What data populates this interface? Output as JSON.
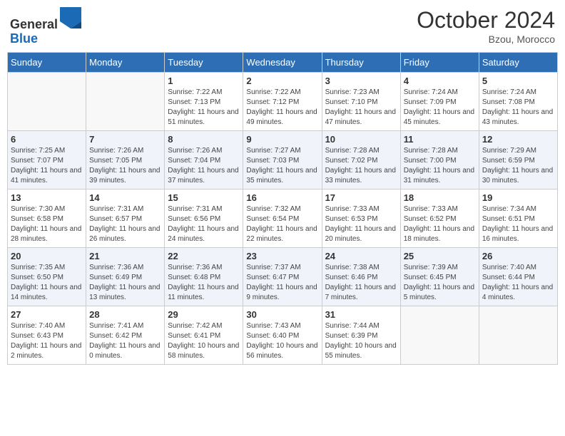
{
  "header": {
    "logo_line1": "General",
    "logo_line2": "Blue",
    "month": "October 2024",
    "location": "Bzou, Morocco"
  },
  "weekdays": [
    "Sunday",
    "Monday",
    "Tuesday",
    "Wednesday",
    "Thursday",
    "Friday",
    "Saturday"
  ],
  "weeks": [
    [
      {
        "day": "",
        "sunrise": "",
        "sunset": "",
        "daylight": ""
      },
      {
        "day": "",
        "sunrise": "",
        "sunset": "",
        "daylight": ""
      },
      {
        "day": "1",
        "sunrise": "Sunrise: 7:22 AM",
        "sunset": "Sunset: 7:13 PM",
        "daylight": "Daylight: 11 hours and 51 minutes."
      },
      {
        "day": "2",
        "sunrise": "Sunrise: 7:22 AM",
        "sunset": "Sunset: 7:12 PM",
        "daylight": "Daylight: 11 hours and 49 minutes."
      },
      {
        "day": "3",
        "sunrise": "Sunrise: 7:23 AM",
        "sunset": "Sunset: 7:10 PM",
        "daylight": "Daylight: 11 hours and 47 minutes."
      },
      {
        "day": "4",
        "sunrise": "Sunrise: 7:24 AM",
        "sunset": "Sunset: 7:09 PM",
        "daylight": "Daylight: 11 hours and 45 minutes."
      },
      {
        "day": "5",
        "sunrise": "Sunrise: 7:24 AM",
        "sunset": "Sunset: 7:08 PM",
        "daylight": "Daylight: 11 hours and 43 minutes."
      }
    ],
    [
      {
        "day": "6",
        "sunrise": "Sunrise: 7:25 AM",
        "sunset": "Sunset: 7:07 PM",
        "daylight": "Daylight: 11 hours and 41 minutes."
      },
      {
        "day": "7",
        "sunrise": "Sunrise: 7:26 AM",
        "sunset": "Sunset: 7:05 PM",
        "daylight": "Daylight: 11 hours and 39 minutes."
      },
      {
        "day": "8",
        "sunrise": "Sunrise: 7:26 AM",
        "sunset": "Sunset: 7:04 PM",
        "daylight": "Daylight: 11 hours and 37 minutes."
      },
      {
        "day": "9",
        "sunrise": "Sunrise: 7:27 AM",
        "sunset": "Sunset: 7:03 PM",
        "daylight": "Daylight: 11 hours and 35 minutes."
      },
      {
        "day": "10",
        "sunrise": "Sunrise: 7:28 AM",
        "sunset": "Sunset: 7:02 PM",
        "daylight": "Daylight: 11 hours and 33 minutes."
      },
      {
        "day": "11",
        "sunrise": "Sunrise: 7:28 AM",
        "sunset": "Sunset: 7:00 PM",
        "daylight": "Daylight: 11 hours and 31 minutes."
      },
      {
        "day": "12",
        "sunrise": "Sunrise: 7:29 AM",
        "sunset": "Sunset: 6:59 PM",
        "daylight": "Daylight: 11 hours and 30 minutes."
      }
    ],
    [
      {
        "day": "13",
        "sunrise": "Sunrise: 7:30 AM",
        "sunset": "Sunset: 6:58 PM",
        "daylight": "Daylight: 11 hours and 28 minutes."
      },
      {
        "day": "14",
        "sunrise": "Sunrise: 7:31 AM",
        "sunset": "Sunset: 6:57 PM",
        "daylight": "Daylight: 11 hours and 26 minutes."
      },
      {
        "day": "15",
        "sunrise": "Sunrise: 7:31 AM",
        "sunset": "Sunset: 6:56 PM",
        "daylight": "Daylight: 11 hours and 24 minutes."
      },
      {
        "day": "16",
        "sunrise": "Sunrise: 7:32 AM",
        "sunset": "Sunset: 6:54 PM",
        "daylight": "Daylight: 11 hours and 22 minutes."
      },
      {
        "day": "17",
        "sunrise": "Sunrise: 7:33 AM",
        "sunset": "Sunset: 6:53 PM",
        "daylight": "Daylight: 11 hours and 20 minutes."
      },
      {
        "day": "18",
        "sunrise": "Sunrise: 7:33 AM",
        "sunset": "Sunset: 6:52 PM",
        "daylight": "Daylight: 11 hours and 18 minutes."
      },
      {
        "day": "19",
        "sunrise": "Sunrise: 7:34 AM",
        "sunset": "Sunset: 6:51 PM",
        "daylight": "Daylight: 11 hours and 16 minutes."
      }
    ],
    [
      {
        "day": "20",
        "sunrise": "Sunrise: 7:35 AM",
        "sunset": "Sunset: 6:50 PM",
        "daylight": "Daylight: 11 hours and 14 minutes."
      },
      {
        "day": "21",
        "sunrise": "Sunrise: 7:36 AM",
        "sunset": "Sunset: 6:49 PM",
        "daylight": "Daylight: 11 hours and 13 minutes."
      },
      {
        "day": "22",
        "sunrise": "Sunrise: 7:36 AM",
        "sunset": "Sunset: 6:48 PM",
        "daylight": "Daylight: 11 hours and 11 minutes."
      },
      {
        "day": "23",
        "sunrise": "Sunrise: 7:37 AM",
        "sunset": "Sunset: 6:47 PM",
        "daylight": "Daylight: 11 hours and 9 minutes."
      },
      {
        "day": "24",
        "sunrise": "Sunrise: 7:38 AM",
        "sunset": "Sunset: 6:46 PM",
        "daylight": "Daylight: 11 hours and 7 minutes."
      },
      {
        "day": "25",
        "sunrise": "Sunrise: 7:39 AM",
        "sunset": "Sunset: 6:45 PM",
        "daylight": "Daylight: 11 hours and 5 minutes."
      },
      {
        "day": "26",
        "sunrise": "Sunrise: 7:40 AM",
        "sunset": "Sunset: 6:44 PM",
        "daylight": "Daylight: 11 hours and 4 minutes."
      }
    ],
    [
      {
        "day": "27",
        "sunrise": "Sunrise: 7:40 AM",
        "sunset": "Sunset: 6:43 PM",
        "daylight": "Daylight: 11 hours and 2 minutes."
      },
      {
        "day": "28",
        "sunrise": "Sunrise: 7:41 AM",
        "sunset": "Sunset: 6:42 PM",
        "daylight": "Daylight: 11 hours and 0 minutes."
      },
      {
        "day": "29",
        "sunrise": "Sunrise: 7:42 AM",
        "sunset": "Sunset: 6:41 PM",
        "daylight": "Daylight: 10 hours and 58 minutes."
      },
      {
        "day": "30",
        "sunrise": "Sunrise: 7:43 AM",
        "sunset": "Sunset: 6:40 PM",
        "daylight": "Daylight: 10 hours and 56 minutes."
      },
      {
        "day": "31",
        "sunrise": "Sunrise: 7:44 AM",
        "sunset": "Sunset: 6:39 PM",
        "daylight": "Daylight: 10 hours and 55 minutes."
      },
      {
        "day": "",
        "sunrise": "",
        "sunset": "",
        "daylight": ""
      },
      {
        "day": "",
        "sunrise": "",
        "sunset": "",
        "daylight": ""
      }
    ]
  ]
}
